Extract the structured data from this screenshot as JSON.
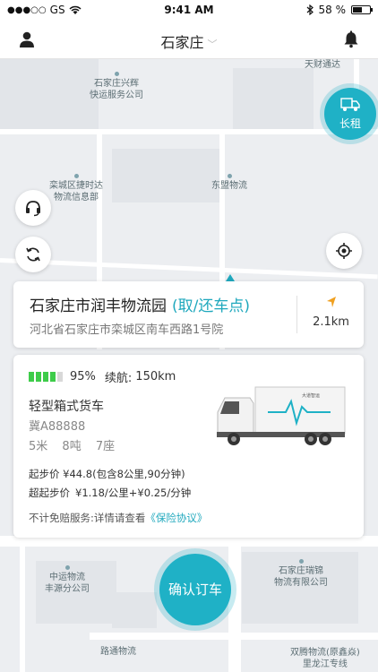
{
  "status_bar": {
    "signal": "●●●○○",
    "carrier": "GS",
    "time": "9:41 AM",
    "battery_text": "58 %",
    "battery_level": 0.58
  },
  "navbar": {
    "city": "石家庄",
    "user_icon": "user-icon",
    "bell_icon": "bell-icon"
  },
  "rent_button": {
    "label": "长租",
    "icon": "truck-icon"
  },
  "map": {
    "labels": [
      {
        "id": "tiancai",
        "text": "天财通达"
      },
      {
        "id": "xinghui",
        "text": "石家庄兴辉\n快运服务公司"
      },
      {
        "id": "jieshida",
        "text": "栾城区捷时达\n物流信息部"
      },
      {
        "id": "dongmeng",
        "text": "东盟物流"
      },
      {
        "id": "zhongyun",
        "text": "中运物流\n丰源分公司"
      },
      {
        "id": "ruijin",
        "text": "石家庄瑞锦\n物流有限公司"
      },
      {
        "id": "lutong",
        "text": "路通物流"
      },
      {
        "id": "shuangteng",
        "text": "双腾物流(原鑫焱)\n里龙江专线"
      }
    ]
  },
  "location_card": {
    "name": "石家庄市润丰物流园",
    "tag": "(取/还车点)",
    "address": "河北省石家庄市栾城区南车西路1号院",
    "distance": "2.1km"
  },
  "vehicle_card": {
    "battery_percent": "95%",
    "battery_level": 0.95,
    "range_label": "续航:",
    "range_value": "150km",
    "type": "轻型箱式货车",
    "plate": "冀A88888",
    "length": "5米",
    "tonnage": "8吨",
    "seats": "7座",
    "base_price": "起步价 ¥44.8(包含8公里,90分钟)",
    "extra_price_label": "超起步价",
    "extra_price_value": "¥1.18/公里+¥0.25/分钟",
    "insurance_text": "不计免赔服务:详情请查看",
    "insurance_link": "《保险协议》",
    "truck_brand_text": "大道智运"
  },
  "confirm_button": {
    "label": "确认订车"
  },
  "colors": {
    "accent": "#1fb1c6",
    "battery_green": "#3ecc4a"
  }
}
